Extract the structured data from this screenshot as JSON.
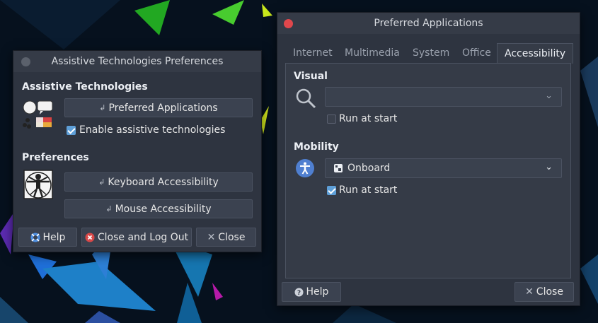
{
  "assistive_window": {
    "title": "Assistive Technologies Preferences",
    "section_assistive": "Assistive Technologies",
    "preferred_apps_button": "Preferred Applications",
    "enable_checkbox_label": "Enable assistive technologies",
    "enable_checked": true,
    "section_preferences": "Preferences",
    "keyboard_button": "Keyboard Accessibility",
    "mouse_button": "Mouse Accessibility",
    "help_button": "Help",
    "logout_button": "Close and Log Out",
    "close_button": "Close"
  },
  "preferred_window": {
    "title": "Preferred Applications",
    "tabs": [
      "Internet",
      "Multimedia",
      "System",
      "Office",
      "Accessibility"
    ],
    "active_tab": "Accessibility",
    "visual": {
      "heading": "Visual",
      "combo_value": "",
      "run_at_start_label": "Run at start",
      "run_at_start_checked": false
    },
    "mobility": {
      "heading": "Mobility",
      "combo_value": "Onboard",
      "run_at_start_label": "Run at start",
      "run_at_start_checked": true
    },
    "help_button": "Help",
    "close_button": "Close"
  },
  "colors": {
    "close_dot_red": "#e0474c",
    "inactive_dot": "#5b616c",
    "accent": "#5e9fd8"
  },
  "icons": {
    "launch": "launch-arrow-icon",
    "help": "help-icon",
    "logout": "logout-icon",
    "close": "close-x-icon",
    "magnifier": "magnifier-icon",
    "accessibility": "accessibility-person-icon",
    "onboard": "onboard-keyboard-icon",
    "assistive_bubbles": "assistive-technologies-icon",
    "vitruvian": "vitruvian-man-icon"
  }
}
